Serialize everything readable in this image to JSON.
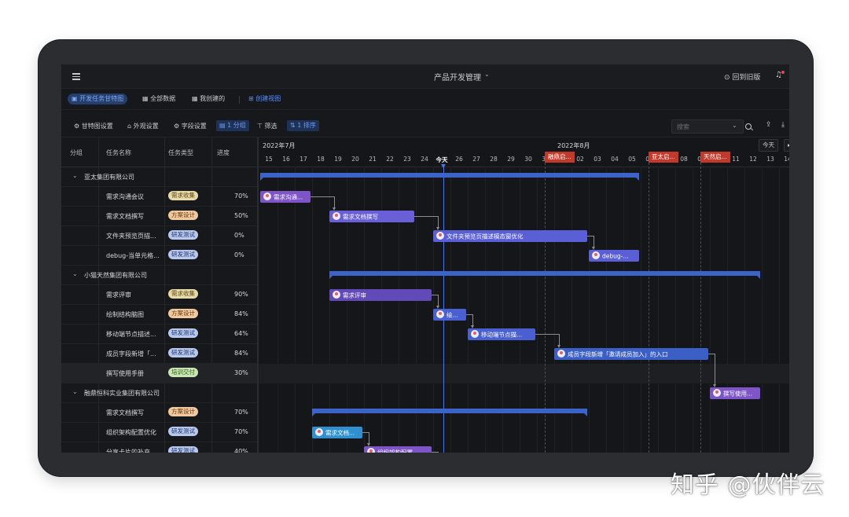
{
  "topbar": {
    "app_title": "产品开发管理",
    "title_caret": "⌄",
    "back_old": "⊙ 回到旧版",
    "bell": "🔔"
  },
  "views": [
    {
      "label": "▣ 开发任务甘特图",
      "active": true
    },
    {
      "label": "▦ 全部数据",
      "active": false
    },
    {
      "label": "▦ 我创建的",
      "active": false
    },
    {
      "label": "⊞ 创建视图",
      "active": false
    }
  ],
  "toolbar": {
    "gantt_settings": "⚙ 甘特图设置",
    "appearance": "⌂ 外观设置",
    "fields": "⚙ 字段设置",
    "group": "▤ 1 分组",
    "filter": "⊤ 筛选",
    "sort": "⇅ 1 排序",
    "search_placeholder": "搜索",
    "search_caret": "⌄"
  },
  "table": {
    "headers": {
      "group": "分组",
      "name": "任务名称",
      "type": "任务类型",
      "progress": "进度"
    },
    "groups": [
      {
        "name": "亚太集团有限公司",
        "tasks": [
          {
            "name": "需求沟通会议",
            "type": "需求收集",
            "progress": "70%"
          },
          {
            "name": "需求文档撰写",
            "type": "方案设计",
            "progress": "50%"
          },
          {
            "name": "文件夹预览页描...",
            "type": "研发测试",
            "progress": "0%"
          },
          {
            "name": "debug-当单元格...",
            "type": "研发测试",
            "progress": "0%"
          }
        ]
      },
      {
        "name": "小猫天然集团有限公司",
        "tasks": [
          {
            "name": "需求评审",
            "type": "需求收集",
            "progress": "90%"
          },
          {
            "name": "绘制结构脑图",
            "type": "方案设计",
            "progress": "84%"
          },
          {
            "name": "移动端节点描述...",
            "type": "研发测试",
            "progress": "64%"
          },
          {
            "name": "成员字段新增「...",
            "type": "研发测试",
            "progress": "84%"
          },
          {
            "name": "撰写使用手册",
            "type": "培训交付",
            "progress": "30%"
          }
        ]
      },
      {
        "name": "融鼎恒科实业集团有限公司",
        "tasks": [
          {
            "name": "需求文档撰写",
            "type": "方案设计",
            "progress": "70%"
          },
          {
            "name": "组织架构配置优化",
            "type": "研发测试",
            "progress": "70%"
          },
          {
            "name": "分享卡片的补充...",
            "type": "研发测试",
            "progress": "40%"
          }
        ]
      }
    ],
    "type_colors": {
      "需求收集": {
        "bg": "#e8d9a8",
        "fg": "#5a4a1a"
      },
      "方案设计": {
        "bg": "#f0c9a0",
        "fg": "#6a3a10"
      },
      "研发测试": {
        "bg": "#b9c8ee",
        "fg": "#1f3566"
      },
      "培训交付": {
        "bg": "#c9e6b3",
        "fg": "#2f5a1a"
      }
    }
  },
  "gantt": {
    "months": [
      "2022年7月",
      "2022年8月"
    ],
    "days": [
      "15",
      "16",
      "17",
      "18",
      "19",
      "20",
      "21",
      "22",
      "23",
      "24",
      "今天",
      "26",
      "27",
      "28",
      "29",
      "30",
      "31",
      "01",
      "02",
      "03",
      "04",
      "05",
      "06",
      "07",
      "08",
      "09",
      "10",
      "11",
      "12",
      "13",
      "14"
    ],
    "today_label": "今天",
    "today_button": "今天",
    "milestones": [
      "融鼎启...",
      "亚太启...",
      "天然启..."
    ],
    "task_bars": [
      {
        "label": "需求沟通...",
        "color": "#7d55c7"
      },
      {
        "label": "需求文档撰写",
        "color": "#6a5fd6"
      },
      {
        "label": "文件夹预览页描述模态窗优化",
        "color": "#5b5fd6"
      },
      {
        "label": "debug-...",
        "color": "#5b5fd6"
      },
      {
        "label": "需求评审",
        "color": "#6249b8"
      },
      {
        "label": "绘...",
        "color": "#4a5fd0"
      },
      {
        "label": "移动端节点描...",
        "color": "#4a5fd0"
      },
      {
        "label": "成员字段新增「邀请成员加入」的入口",
        "color": "#3c5fc6"
      },
      {
        "label": "撰写使用...",
        "color": "#7d55c7"
      },
      {
        "label": "需求文档...",
        "color": "#2f8fcf"
      },
      {
        "label": "组织架构配置...",
        "color": "#7d55c7"
      },
      {
        "label": "分享卡片...",
        "color": "#4a5fd0"
      }
    ],
    "accent_today": "#4a78e0",
    "accent_milestone": "#c0392b"
  },
  "watermark": "知乎 @伙伴云"
}
